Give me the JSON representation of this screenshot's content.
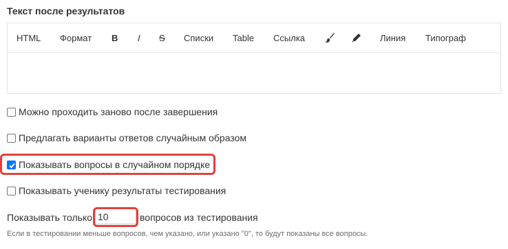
{
  "section_title": "Текст после результатов",
  "toolbar": {
    "html": "HTML",
    "format": "Формат",
    "bold": "B",
    "italic": "I",
    "strike": "S",
    "lists": "Списки",
    "table": "Table",
    "link": "Ссылка",
    "brush_icon": "brush-icon",
    "pen_icon": "pen-icon",
    "line": "Линия",
    "typograph": "Типограф"
  },
  "options": [
    {
      "label": "Можно проходить заново после завершения",
      "checked": false
    },
    {
      "label": "Предлагать варианты ответов случайным образом",
      "checked": false
    },
    {
      "label": "Показывать вопросы в случайном порядке",
      "checked": true
    },
    {
      "label": "Показывать ученику результаты тестирования",
      "checked": false
    }
  ],
  "limit": {
    "prefix": "Показывать только",
    "value": "10",
    "suffix": "вопросов из тестирования"
  },
  "hint": "Если в тестировании меньше вопросов, чем указано, или указано \"0\", то будут показаны все вопросы.",
  "colors": {
    "highlight": "#e0413b",
    "checkbox_checked": "#0075ff"
  }
}
